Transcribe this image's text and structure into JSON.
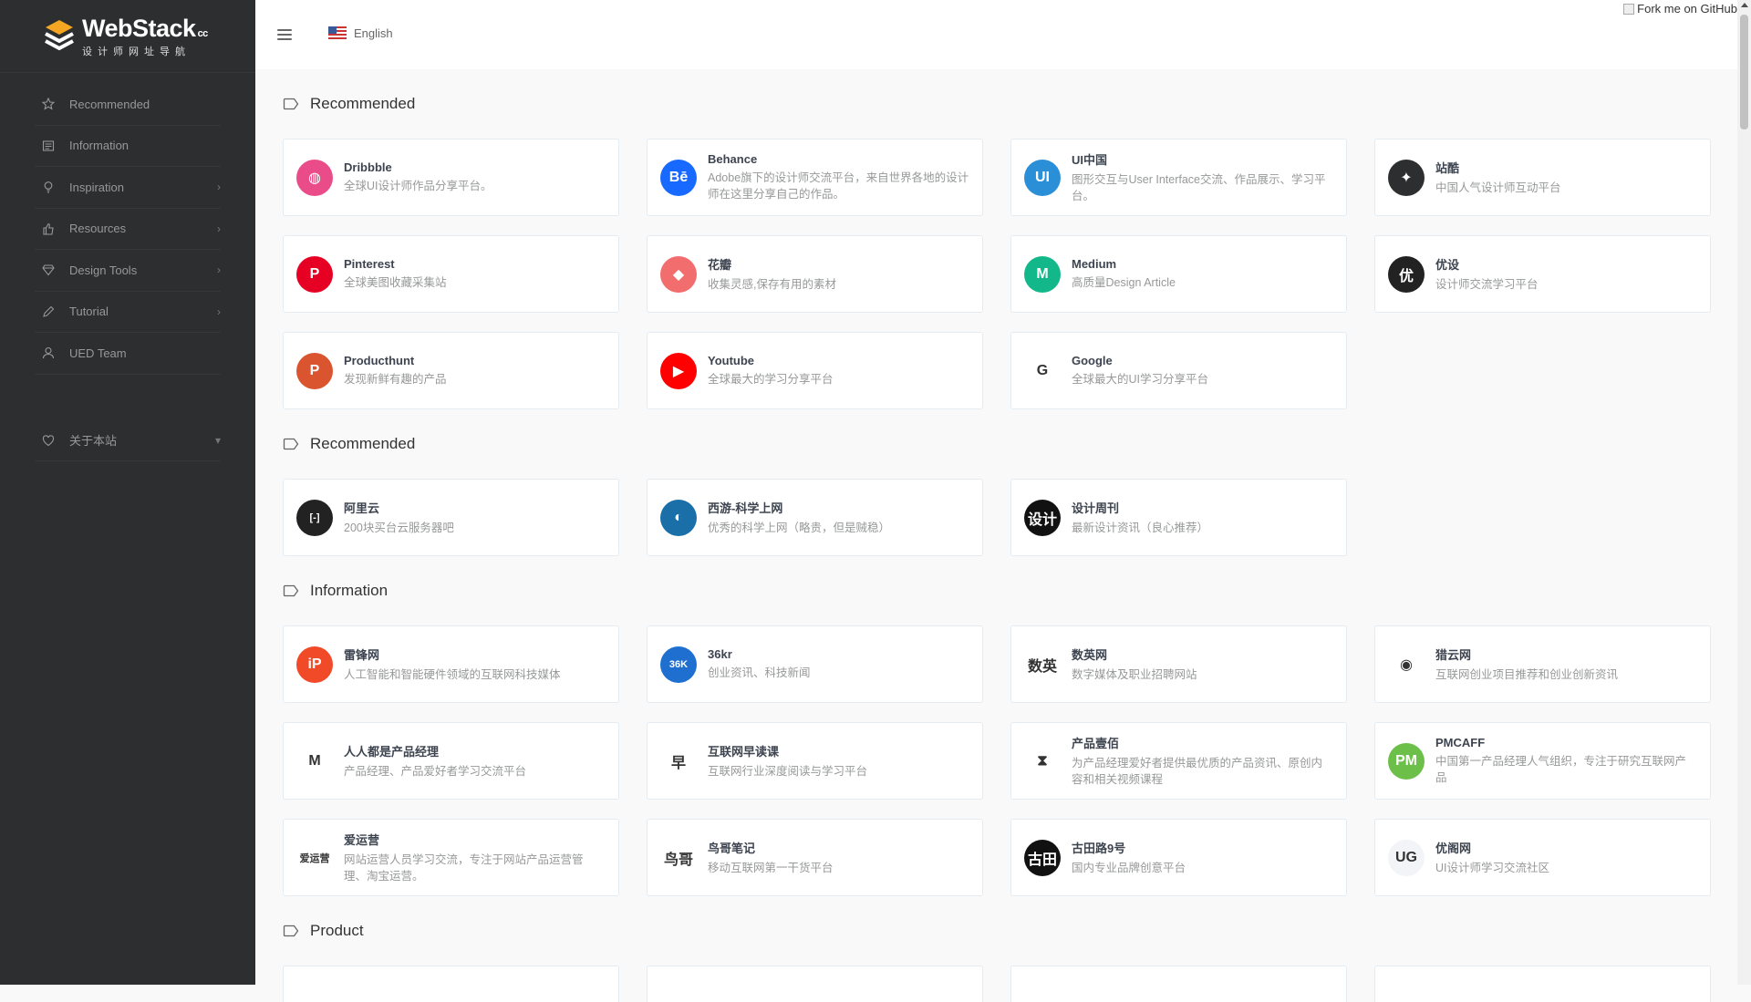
{
  "brand": {
    "name": "WebStack",
    "suffix": "cc",
    "subtitle": "设计师网址导航"
  },
  "sidebar": {
    "items": [
      {
        "label": "Recommended",
        "icon": "star-icon",
        "arrow": ""
      },
      {
        "label": "Information",
        "icon": "newspaper-icon",
        "arrow": ""
      },
      {
        "label": "Inspiration",
        "icon": "lightbulb-icon",
        "arrow": "›"
      },
      {
        "label": "Resources",
        "icon": "thumbs-up-icon",
        "arrow": "›"
      },
      {
        "label": "Design Tools",
        "icon": "diamond-icon",
        "arrow": "›"
      },
      {
        "label": "Tutorial",
        "icon": "pencil-icon",
        "arrow": "›"
      },
      {
        "label": "UED Team",
        "icon": "user-icon",
        "arrow": ""
      }
    ],
    "about": {
      "label": "关于本站",
      "icon": "heart-icon",
      "arrow": "▾"
    }
  },
  "topbar": {
    "language": "English",
    "fork": "Fork me on GitHub"
  },
  "sections": [
    {
      "title": "Recommended",
      "cards": [
        {
          "title": "Dribbble",
          "desc": "全球UI设计师作品分享平台。",
          "color": "#ea4c89",
          "glyph": "◍"
        },
        {
          "title": "Behance",
          "desc": "Adobe旗下的设计师交流平台，来自世界各地的设计师在这里分享自己的作品。",
          "color": "#1769ff",
          "glyph": "Bē"
        },
        {
          "title": "UI中国",
          "desc": "图形交互与User Interface交流、作品展示、学习平台。",
          "color": "#2b8fd8",
          "glyph": "UI"
        },
        {
          "title": "站酷",
          "desc": "中国人气设计师互动平台",
          "color": "#2c2e2f",
          "glyph": "✦"
        },
        {
          "title": "Pinterest",
          "desc": "全球美图收藏采集站",
          "color": "#e60023",
          "glyph": "P"
        },
        {
          "title": "花瓣",
          "desc": "收集灵感,保存有用的素材",
          "color": "#f26d6d",
          "glyph": "◆"
        },
        {
          "title": "Medium",
          "desc": "高质量Design Article",
          "color": "#13b88a",
          "glyph": "M"
        },
        {
          "title": "优设",
          "desc": "设计师交流学习平台",
          "color": "#222222",
          "glyph": "优"
        },
        {
          "title": "Producthunt",
          "desc": "发现新鲜有趣的产品",
          "color": "#da552f",
          "glyph": "P"
        },
        {
          "title": "Youtube",
          "desc": "全球最大的学习分享平台",
          "color": "#ff0000",
          "glyph": "▶"
        },
        {
          "title": "Google",
          "desc": "全球最大的UI学习分享平台",
          "color": "#ffffff",
          "glyph": "G"
        }
      ]
    },
    {
      "title": "Recommended",
      "cards": [
        {
          "title": "阿里云",
          "desc": "200块买台云服务器吧",
          "color": "#222222",
          "glyph": "[-]"
        },
        {
          "title": "西游-科学上网",
          "desc": "优秀的科学上网（略贵，但是贼稳）",
          "color": "#1a6fa8",
          "glyph": "◐"
        },
        {
          "title": "设计周刊",
          "desc": "最新设计资讯（良心推荐）",
          "color": "#111111",
          "glyph": "设计"
        }
      ]
    },
    {
      "title": "Information",
      "cards": [
        {
          "title": "雷锋网",
          "desc": "人工智能和智能硬件领域的互联网科技媒体",
          "color": "#f14a29",
          "glyph": "iP"
        },
        {
          "title": "36kr",
          "desc": "创业资讯、科技新闻",
          "color": "#1f6fd1",
          "glyph": "36K"
        },
        {
          "title": "数英网",
          "desc": "数字媒体及职业招聘网站",
          "color": "#ffffff",
          "glyph": "数英"
        },
        {
          "title": "猎云网",
          "desc": "互联网创业项目推荐和创业创新资讯",
          "color": "#ffffff",
          "glyph": "◉"
        },
        {
          "title": "人人都是产品经理",
          "desc": "产品经理、产品爱好者学习交流平台",
          "color": "#ffffff",
          "glyph": "M"
        },
        {
          "title": "互联网早读课",
          "desc": "互联网行业深度阅读与学习平台",
          "color": "#ffffff",
          "glyph": "早"
        },
        {
          "title": "产品壹佰",
          "desc": "为产品经理爱好者提供最优质的产品资讯、原创内容和相关视频课程",
          "color": "#ffffff",
          "glyph": "⧗"
        },
        {
          "title": "PMCAFF",
          "desc": "中国第一产品经理人气组织，专注于研究互联网产品",
          "color": "#6cc04a",
          "glyph": "PM"
        },
        {
          "title": "爱运营",
          "desc": "网站运营人员学习交流，专注于网站产品运营管理、淘宝运营。",
          "color": "#ffffff",
          "glyph": "爱运营"
        },
        {
          "title": "鸟哥笔记",
          "desc": "移动互联网第一干货平台",
          "color": "#ffffff",
          "glyph": "鸟哥"
        },
        {
          "title": "古田路9号",
          "desc": "国内专业品牌创意平台",
          "color": "#111111",
          "glyph": "古田"
        },
        {
          "title": "优阁网",
          "desc": "UI设计师学习交流社区",
          "color": "#f2f4f8",
          "glyph": "UG"
        }
      ]
    },
    {
      "title": "Product",
      "cards": [
        {
          "title": "",
          "desc": ""
        },
        {
          "title": "",
          "desc": ""
        },
        {
          "title": "",
          "desc": ""
        },
        {
          "title": "",
          "desc": ""
        }
      ]
    }
  ]
}
